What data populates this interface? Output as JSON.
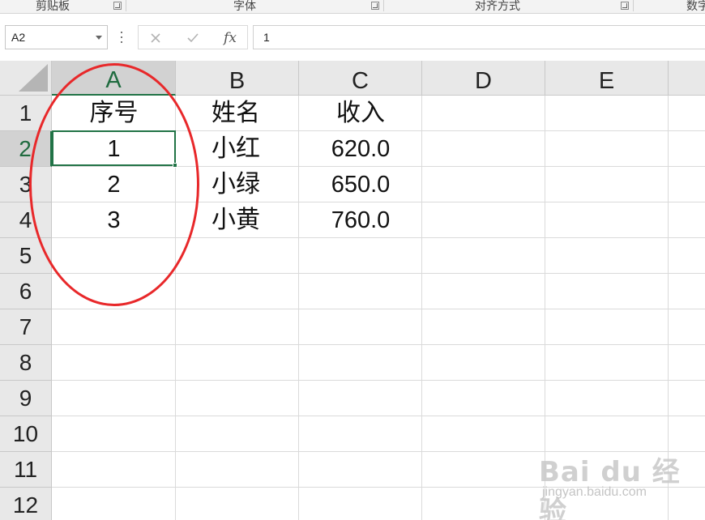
{
  "ribbon": {
    "groups": [
      {
        "label": "剪贴板"
      },
      {
        "label": "字体"
      },
      {
        "label": "对齐方式"
      },
      {
        "label": "数字"
      }
    ]
  },
  "formula_bar": {
    "name_box": "A2",
    "cancel_icon": "close-icon",
    "enter_icon": "check-icon",
    "function_label": "fx",
    "value": "1"
  },
  "sheet": {
    "columns": [
      "A",
      "B",
      "C",
      "D",
      "E"
    ],
    "rows": [
      "1",
      "2",
      "3",
      "4",
      "5",
      "6",
      "7",
      "8",
      "9",
      "10",
      "11",
      "12"
    ],
    "selected_cell": "A2",
    "cells": [
      [
        "序号",
        "姓名",
        "收入"
      ],
      [
        "1",
        "小红",
        "620.0"
      ],
      [
        "2",
        "小绿",
        "650.0"
      ],
      [
        "3",
        "小黄",
        "760.0"
      ]
    ]
  },
  "colors": {
    "accent": "#217346",
    "annotation": "#e8282a",
    "header_bg": "#e8e8e8"
  },
  "watermark": {
    "brand": "Bai du 经验",
    "url": "jingyan.baidu.com"
  }
}
